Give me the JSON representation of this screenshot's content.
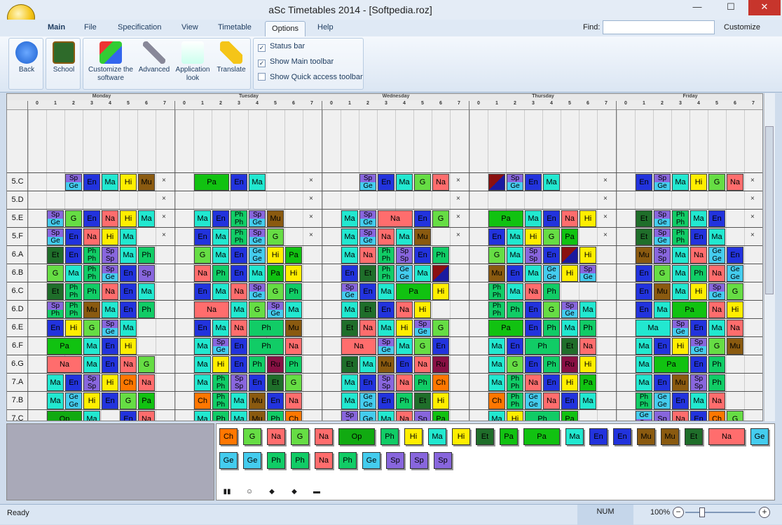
{
  "app": {
    "title": "aSc Timetables 2014  - [Softpedia.roz]"
  },
  "tabs": [
    "Main",
    "File",
    "Specification",
    "View",
    "Timetable",
    "Options",
    "Help"
  ],
  "find_label": "Find:",
  "customize": "Customize",
  "ribbon": {
    "back": "Back",
    "school": "School",
    "customize": "Customize the software",
    "advanced": "Advanced",
    "appearance": "Application look",
    "translate": "Translate",
    "status_bar": "Status bar",
    "show_main_toolbar": "Show Main toolbar",
    "show_quick_toolbar": "Show Quick access toolbar"
  },
  "days": [
    "Monday",
    "Tuesday",
    "Wednesday",
    "Thursday",
    "Friday"
  ],
  "periods": [
    "0",
    "1",
    "2",
    "3",
    "4",
    "5",
    "6",
    "7"
  ],
  "rows": [
    {
      "label": "5.C",
      "cells": [
        null,
        null,
        "Sp|Ge",
        "En",
        "Ma",
        "Hi",
        "Mu",
        "×",
        null,
        "Pa",
        "Pa",
        "En",
        "Ma",
        null,
        null,
        "×",
        null,
        null,
        "Sp|Ge",
        "En",
        "Ma",
        "G",
        "Na",
        "×",
        null,
        "/",
        "Sp|Ge",
        "En",
        "Ma",
        null,
        null,
        "×",
        null,
        "En",
        "Sp|Ge",
        "Ma",
        "Hi",
        "G",
        "Na",
        "×"
      ]
    },
    {
      "label": "5.D",
      "cells": [
        null,
        null,
        null,
        null,
        null,
        null,
        null,
        "×",
        null,
        null,
        null,
        null,
        null,
        null,
        null,
        "×",
        null,
        null,
        null,
        null,
        null,
        null,
        null,
        "×",
        null,
        null,
        null,
        null,
        null,
        null,
        null,
        "×",
        null,
        null,
        null,
        null,
        null,
        null,
        null,
        "×"
      ]
    },
    {
      "label": "5.E",
      "cells": [
        null,
        "Sp|Ge",
        "G",
        "En",
        "Na",
        "Hi",
        "Ma",
        "×",
        null,
        "Ma",
        "En",
        "Ph|Ph",
        "Sp|Ge",
        "Mu",
        null,
        "×",
        null,
        "Ma",
        "Sp|Ge",
        "Na",
        "Na",
        "En",
        "G",
        "×",
        null,
        "Pa",
        "Pa",
        "Ma",
        "En",
        "Na",
        "Hi",
        "×",
        null,
        "Et",
        "Sp|Ge",
        "Ph|Ph",
        "Ma",
        "En",
        null,
        "×"
      ]
    },
    {
      "label": "5.F",
      "cells": [
        null,
        "Sp|Ge",
        "En",
        "Na",
        "Hi",
        "Ma",
        null,
        "×",
        null,
        "En",
        "Ma",
        "Ph|Ph",
        "Sp|Ge",
        "G",
        null,
        "×",
        null,
        "Ma",
        "Sp|Ge",
        "Na",
        "Ma",
        "Mu",
        null,
        "×",
        null,
        "En",
        "Ma",
        "Hi",
        "G",
        "Pa",
        null,
        "×",
        null,
        "Et",
        "Sp|Ge",
        "Ph|Ph",
        "En",
        "Ma",
        null,
        "×"
      ]
    },
    {
      "label": "6.A",
      "cells": [
        null,
        "Et",
        "En",
        "Ph|Ph",
        "Sp|Sp",
        "Ma",
        "Ph",
        null,
        null,
        "G",
        "Ma",
        "En",
        "Ge|Ge",
        "Hi",
        "Pa",
        null,
        null,
        "Ma",
        "Na",
        "Ph|Ph",
        "Sp|Sp",
        "En",
        "Ph",
        null,
        null,
        "G",
        "Ma",
        "Sp|Sp",
        "En",
        "/",
        "Hi",
        null,
        null,
        "Mu",
        "Sp|Sp",
        "Ma",
        "Na",
        "Ge|Ge",
        "En",
        null
      ]
    },
    {
      "label": "6.B",
      "cells": [
        null,
        "G",
        "Ma",
        "Ph|Ph",
        "Sp|Ge",
        "En",
        "Sp",
        null,
        null,
        "Na",
        "Ph",
        "En",
        "Ma",
        "Pa",
        "Hi",
        null,
        null,
        "En",
        "Et",
        "Ph|Ph",
        "Ge|Ge",
        "Ma",
        "/",
        null,
        null,
        "Mu",
        "En",
        "Ma",
        "Ge|Ge",
        "Hi",
        "Sp|Ge",
        null,
        null,
        "En",
        "G",
        "Ma",
        "Ph",
        "Na",
        "Ge|Ge",
        null
      ]
    },
    {
      "label": "6.C",
      "cells": [
        null,
        "Et",
        "Ph|Ph",
        "Ph",
        "Na",
        "En",
        "Ma",
        null,
        null,
        "En",
        "Ma",
        "Na",
        "Sp|Ge",
        "G",
        "Ph",
        null,
        null,
        "Sp|Ge",
        "En",
        "Ma",
        "Pa",
        "Pa",
        "Hi",
        null,
        null,
        "Ph|Ph",
        "Ma",
        "Na",
        "Ph",
        null,
        null,
        null,
        null,
        "En",
        "Mu",
        "Ma",
        "Hi",
        "Sp|Ge",
        "G",
        null
      ]
    },
    {
      "label": "6.D",
      "cells": [
        null,
        "Sp|Ph",
        "Ph|Ph",
        "Mu",
        "Ma",
        "En",
        "Ph",
        null,
        null,
        "Na",
        "Na",
        "Ma",
        "G",
        "Sp|Ge",
        "Ma",
        null,
        null,
        "Ma",
        "Et",
        "En",
        "Na",
        "Hi",
        null,
        null,
        null,
        "Ph|Ph",
        "Ph",
        "En",
        "G",
        "Sp|Ge",
        "Ma",
        null,
        null,
        "En",
        "Ma",
        "Pa",
        "Pa",
        "Na",
        "Hi",
        null
      ]
    },
    {
      "label": "6.E",
      "cells": [
        null,
        "En",
        "Hi",
        "G",
        "Sp|Ge",
        "Ma",
        null,
        null,
        null,
        "En",
        "Ma",
        "Na",
        "Ph",
        "Ph",
        "Mu",
        null,
        null,
        "Et",
        "Na",
        "Ma",
        "Hi",
        "Sp|Ge",
        "G",
        null,
        null,
        "Pa",
        "Pa",
        "En",
        "Ph",
        "Ma",
        "Ph",
        null,
        null,
        "Ma",
        "Ma",
        "Sp|Ge",
        "En",
        "Ma",
        "Na",
        null
      ]
    },
    {
      "label": "6.F",
      "cells": [
        null,
        "Pa",
        "Pa",
        "Ma",
        "En",
        "Hi",
        null,
        null,
        null,
        "Ma",
        "Sp|Ge",
        "En",
        "Ph",
        "Ph",
        "Na",
        null,
        null,
        "Na",
        "Na",
        "Sp|Ge",
        "Ma",
        "G",
        "En",
        null,
        null,
        "Ma",
        "En",
        "Ph",
        "Ph",
        "Et",
        "Na",
        null,
        null,
        "Ma",
        "En",
        "Hi",
        "Sp|Ge",
        "G",
        "Mu",
        null
      ]
    },
    {
      "label": "6.G",
      "cells": [
        null,
        "Na",
        "Na",
        "Ma",
        "En",
        "Na",
        "G",
        null,
        null,
        "Ma",
        "Hi",
        "En",
        "Ph",
        "Ru",
        "Ph",
        null,
        null,
        "Et",
        "Ma",
        "Mu",
        "En",
        "Na",
        "Ru",
        null,
        null,
        "Ma",
        "G",
        "En",
        "Ph",
        "Ru",
        "Hi",
        null,
        null,
        "Ma",
        "Pa",
        "Pa",
        "En",
        "Ph",
        null,
        null
      ]
    },
    {
      "label": "7.A",
      "cells": [
        null,
        "Ma",
        "En",
        "Sp|Sp",
        "Hi",
        "Ch",
        "Na",
        null,
        null,
        "Ma",
        "Ph|Ph",
        "Sp|Sp",
        "En",
        "Et",
        "G",
        null,
        null,
        "Ma",
        "En",
        "Sp|Sp",
        "Na",
        "Ph",
        "Ch",
        null,
        null,
        "Ma",
        "Ph|Ph",
        "Na",
        "En",
        "Hi",
        "Pa",
        null,
        null,
        "Ma",
        "En",
        "Mu",
        "Sp|Sp",
        "Ph",
        null,
        null
      ]
    },
    {
      "label": "7.B",
      "cells": [
        null,
        "Ma",
        "Ge|Ge",
        "Hi",
        "En",
        "G",
        "Pa",
        null,
        null,
        "Ch",
        "Ph|Ph",
        "Ma",
        "Mu",
        "En",
        "Na",
        null,
        null,
        "Ma",
        "Ge|Ge",
        "En",
        "Ph",
        "Et",
        "Hi",
        null,
        null,
        "Ch",
        "Ph|Ph",
        "Ge|Ge",
        "Na",
        "En",
        "Ma",
        null,
        null,
        "Ph|Ph",
        "Ge|Ge",
        "En",
        "Ma",
        "Na",
        null,
        null
      ]
    },
    {
      "label": "7.C",
      "cells": [
        null,
        "Op",
        "Op",
        "Ma",
        null,
        "En",
        "Na",
        null,
        null,
        "Ma",
        "Ph",
        "Ma",
        "Mu",
        "Ph",
        "Ch",
        null,
        null,
        "Sp|Sp",
        "Ge",
        "Ma",
        "Na",
        "Sp",
        "Pa",
        null,
        null,
        "Ma",
        "Hi",
        "Ph",
        "Ph",
        "Pa",
        null,
        null,
        null,
        "Ge|Sp",
        "Sp",
        "Na",
        "En",
        "Ch",
        "G",
        null
      ]
    }
  ],
  "pool": [
    "Ch",
    "G",
    "Na",
    "G",
    "Na",
    "Op",
    "Ph",
    "Hi",
    "Ma",
    "Hi",
    "Et",
    "Pa",
    "Pa",
    "Ma",
    "En",
    "En",
    "Mu",
    "Mu",
    "Et",
    "Na",
    "Ge",
    "Ge",
    "Ge",
    "Ph",
    "Ph",
    "Na",
    "Ph",
    "Ge",
    "Sp",
    "Sp",
    "Sp"
  ],
  "status": {
    "ready": "Ready",
    "num": "NUM",
    "zoom": "100%"
  },
  "colors": {
    "En": "#2233dd",
    "Ma": "#22e8d0",
    "Na": "#ff6d6d",
    "Hi": "#ff33dd",
    "G": "#66dd44",
    "Mu": "#8a5a10",
    "Ph": "#11cc66",
    "Sp": "#8866dd",
    "Ge": "#44ccee",
    "Pa": "#11c211",
    "Et": "#1f6e2a",
    "Ch": "#ff7700",
    "Ru": "#881144",
    "Op": "#11aa11",
    "Hi2": "#ffee00",
    "Ma2": "#22eeee"
  }
}
